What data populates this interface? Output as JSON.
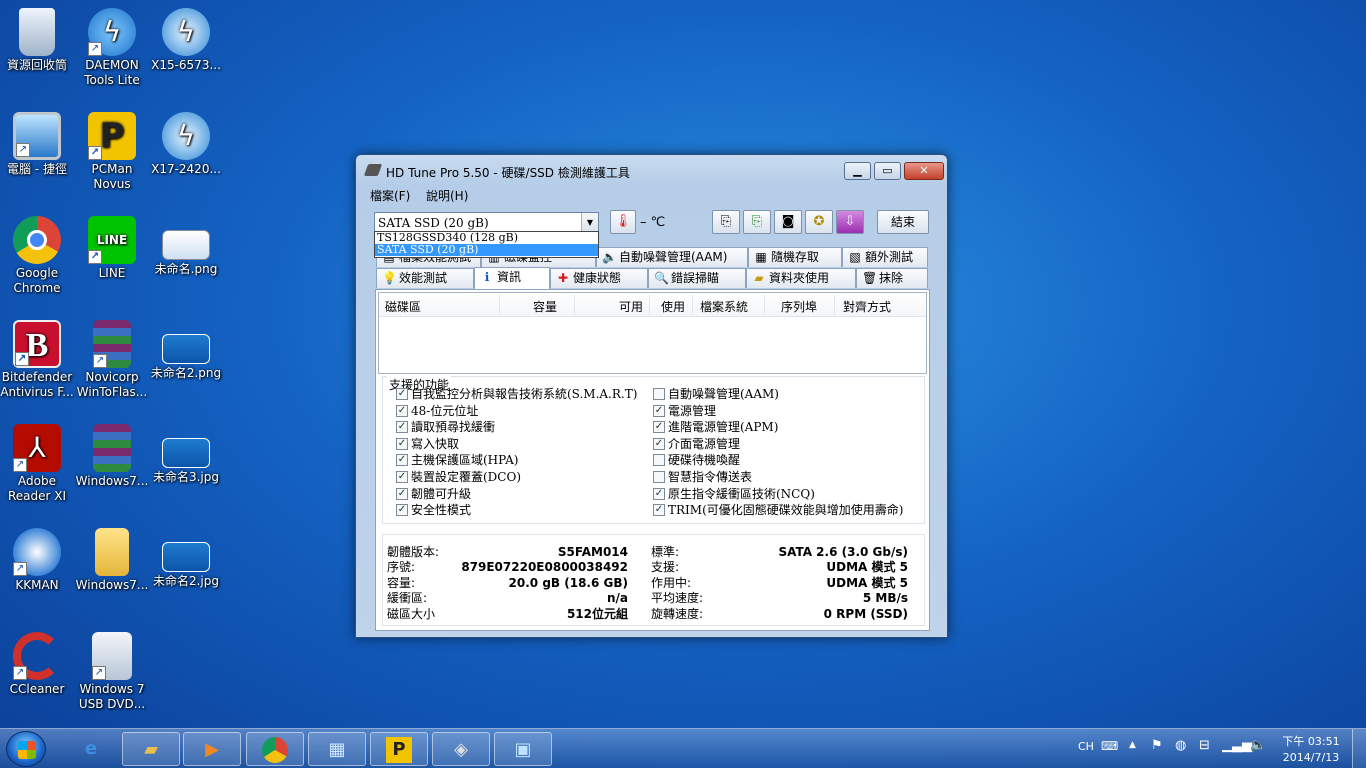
{
  "desktop": {
    "icons": [
      {
        "label": "資源回收筒"
      },
      {
        "label": "DAEMON Tools Lite"
      },
      {
        "label": "X15-6573..."
      },
      {
        "label": "電腦 - 捷徑"
      },
      {
        "label": "PCMan Novus"
      },
      {
        "label": "X17-2420..."
      },
      {
        "label": "Google Chrome"
      },
      {
        "label": "LINE"
      },
      {
        "label": "未命名.png"
      },
      {
        "label": "Bitdefender Antivirus F..."
      },
      {
        "label": "Novicorp WinToFlas..."
      },
      {
        "label": "未命名2.png"
      },
      {
        "label": "Adobe Reader XI"
      },
      {
        "label": "Windows7..."
      },
      {
        "label": "未命名3.jpg"
      },
      {
        "label": "KKMAN"
      },
      {
        "label": "Windows7..."
      },
      {
        "label": "未命名2.jpg"
      },
      {
        "label": "CCleaner"
      },
      {
        "label": "Windows 7 USB DVD..."
      }
    ]
  },
  "window": {
    "title": "HD Tune Pro 5.50 - 硬碟/SSD 檢測維護工具",
    "menu": [
      "檔案(F)",
      "說明(H)"
    ],
    "drive_selected": "SATA SSD (20 gB)",
    "drive_options": [
      "TS128GSSD340 (128 gB)",
      "SATA SSD (20 gB)"
    ],
    "temperature": "– ℃",
    "exit_label": "結束",
    "tabs_row1": [
      "檔案效能測試",
      "磁碟監控",
      "自動噪聲管理(AAM)",
      "隨機存取",
      "額外測試"
    ],
    "tabs_row2": [
      "效能測試",
      "資訊",
      "健康狀態",
      "錯誤掃瞄",
      "資料夾使用",
      "抹除"
    ],
    "columns": [
      "磁碟區",
      "容量",
      "可用",
      "使用",
      "檔案系統",
      "序列埠",
      "對齊方式"
    ],
    "features_title": "支援的功能",
    "features_left": [
      {
        "label": "自我監控分析與報告技術系統(S.M.A.R.T)",
        "checked": true
      },
      {
        "label": "48-位元位址",
        "checked": true
      },
      {
        "label": "讀取預尋找緩衝",
        "checked": true
      },
      {
        "label": "寫入快取",
        "checked": true
      },
      {
        "label": "主機保護區域(HPA)",
        "checked": true
      },
      {
        "label": "裝置設定覆蓋(DCO)",
        "checked": true
      },
      {
        "label": "韌體可升級",
        "checked": true
      },
      {
        "label": "安全性模式",
        "checked": true
      }
    ],
    "features_right": [
      {
        "label": "自動噪聲管理(AAM)",
        "checked": false
      },
      {
        "label": "電源管理",
        "checked": true
      },
      {
        "label": "進階電源管理(APM)",
        "checked": true
      },
      {
        "label": "介面電源管理",
        "checked": true
      },
      {
        "label": "硬碟待機喚醒",
        "checked": false
      },
      {
        "label": "智慧指令傳送表",
        "checked": false
      },
      {
        "label": "原生指令緩衝區技術(NCQ)",
        "checked": true
      },
      {
        "label": "TRIM(可優化固態硬碟效能與增加使用壽命)",
        "checked": true
      }
    ],
    "info_left": [
      {
        "label": "韌體版本:",
        "value": "S5FAM014"
      },
      {
        "label": "序號:",
        "value": "879E07220E0800038492"
      },
      {
        "label": "容量:",
        "value": "20.0 gB (18.6 GB)"
      },
      {
        "label": "緩衝區:",
        "value": "n/a"
      },
      {
        "label": "磁區大小",
        "value": "512位元組"
      }
    ],
    "info_right": [
      {
        "label": "標準:",
        "value": "SATA 2.6 (3.0 Gb/s)"
      },
      {
        "label": "支援:",
        "value": "UDMA 模式 5"
      },
      {
        "label": "作用中:",
        "value": "UDMA 模式 5"
      },
      {
        "label": "平均速度:",
        "value": "5 MB/s"
      },
      {
        "label": "旋轉速度:",
        "value": "0 RPM (SSD)"
      }
    ]
  },
  "taskbar": {
    "lang": "CH",
    "time": "下午 03:51",
    "date": "2014/7/13"
  }
}
